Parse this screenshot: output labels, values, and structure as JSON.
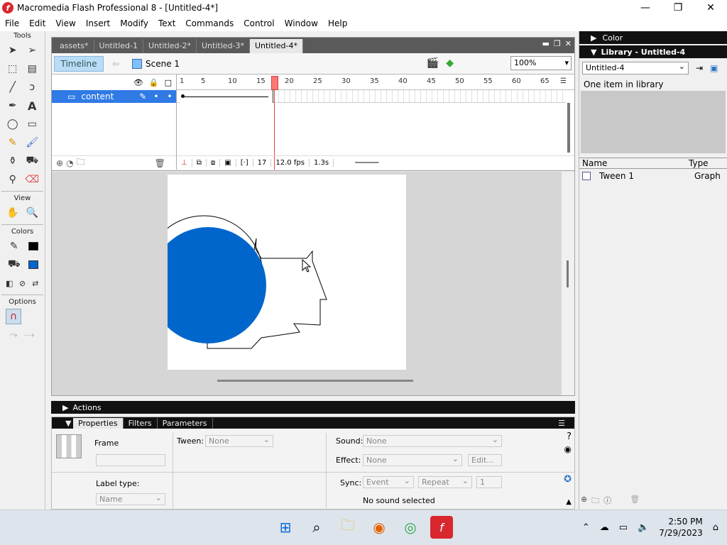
{
  "window": {
    "title": "Macromedia Flash Professional 8 - [Untitled-4*]",
    "app_icon": "f"
  },
  "menu": [
    "File",
    "Edit",
    "View",
    "Insert",
    "Modify",
    "Text",
    "Commands",
    "Control",
    "Window",
    "Help"
  ],
  "tools": {
    "title": "Tools",
    "view_title": "View",
    "colors_title": "Colors",
    "options_title": "Options",
    "stroke_color": "#000000",
    "fill_color": "#0066cc"
  },
  "document": {
    "tabs": [
      "assets*",
      "Untitled-1",
      "Untitled-2*",
      "Untitled-3*",
      "Untitled-4*"
    ],
    "active_tab": 4,
    "timeline_button": "Timeline",
    "scene_label": "Scene 1",
    "zoom": "100%"
  },
  "timeline": {
    "layer_name": "content",
    "ruler": [
      "1",
      "5",
      "10",
      "15",
      "20",
      "25",
      "30",
      "35",
      "40",
      "45",
      "50",
      "55",
      "60",
      "65"
    ],
    "current_frame": "17",
    "fps": "12.0 fps",
    "time": "1.3s"
  },
  "stage": {
    "circle_fill": "#0066cc"
  },
  "actions": {
    "label": "Actions"
  },
  "properties": {
    "tabs": [
      "Properties",
      "Filters",
      "Parameters"
    ],
    "frame_label": "Frame",
    "tween_label": "Tween:",
    "tween_value": "None",
    "label_type_label": "Label type:",
    "label_type_value": "Name",
    "sound_label": "Sound:",
    "sound_value": "None",
    "effect_label": "Effect:",
    "effect_value": "None",
    "edit_button": "Edit...",
    "sync_label": "Sync:",
    "sync_value": "Event",
    "repeat_value": "Repeat",
    "repeat_count": "1",
    "sound_status": "No sound selected"
  },
  "right_panel": {
    "color_title": "Color",
    "library_title": "Library - Untitled-4",
    "library_select": "Untitled-4",
    "item_count": "One item in library",
    "col_name": "Name",
    "col_type": "Type",
    "items": [
      {
        "name": "Tween 1",
        "type": "Graph"
      }
    ]
  },
  "taskbar": {
    "time": "2:50 PM",
    "date": "7/29/2023"
  }
}
